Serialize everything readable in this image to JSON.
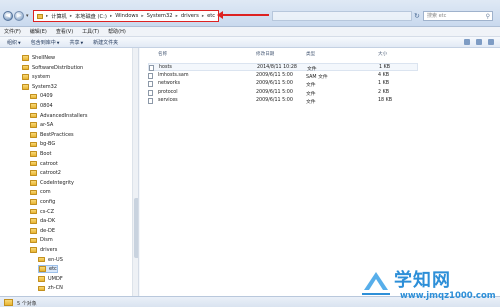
{
  "address": {
    "segments": [
      "计算机",
      "本地磁盘 (C:)",
      "Windows",
      "System32",
      "drivers",
      "etc"
    ],
    "search_placeholder": "搜索 etc"
  },
  "menu": [
    "文件(F)",
    "编辑(E)",
    "查看(V)",
    "工具(T)",
    "帮助(H)"
  ],
  "toolbar": [
    "组织",
    "包含到库中",
    "共享",
    "新建文件夹"
  ],
  "tree": {
    "items": [
      {
        "label": "ShellNew",
        "indent": 1
      },
      {
        "label": "SoftwareDistribution",
        "indent": 1
      },
      {
        "label": "system",
        "indent": 1
      },
      {
        "label": "System32",
        "indent": 1
      },
      {
        "label": "0409",
        "indent": 2
      },
      {
        "label": "0804",
        "indent": 2
      },
      {
        "label": "AdvancedInstallers",
        "indent": 2
      },
      {
        "label": "ar-SA",
        "indent": 2
      },
      {
        "label": "BestPractices",
        "indent": 2
      },
      {
        "label": "bg-BG",
        "indent": 2
      },
      {
        "label": "Boot",
        "indent": 2
      },
      {
        "label": "catroot",
        "indent": 2
      },
      {
        "label": "catroot2",
        "indent": 2
      },
      {
        "label": "CodeIntegrity",
        "indent": 2
      },
      {
        "label": "com",
        "indent": 2
      },
      {
        "label": "config",
        "indent": 2
      },
      {
        "label": "cs-CZ",
        "indent": 2
      },
      {
        "label": "da-DK",
        "indent": 2
      },
      {
        "label": "de-DE",
        "indent": 2
      },
      {
        "label": "Dism",
        "indent": 2
      },
      {
        "label": "drivers",
        "indent": 2
      },
      {
        "label": "en-US",
        "indent": 3
      },
      {
        "label": "etc",
        "indent": 3,
        "selected": true
      },
      {
        "label": "UMDF",
        "indent": 3
      },
      {
        "label": "zh-CN",
        "indent": 3
      }
    ]
  },
  "filelist": {
    "headers": [
      "名称",
      "修改日期",
      "类型",
      "大小"
    ],
    "rows": [
      {
        "name": "hosts",
        "date": "2014/8/11 10:28",
        "type": "文件",
        "size": "1 KB"
      },
      {
        "name": "lmhosts.sam",
        "date": "2009/6/11 5:00",
        "type": "SAM 文件",
        "size": "4 KB"
      },
      {
        "name": "networks",
        "date": "2009/6/11 5:00",
        "type": "文件",
        "size": "1 KB"
      },
      {
        "name": "protocol",
        "date": "2009/6/11 5:00",
        "type": "文件",
        "size": "2 KB"
      },
      {
        "name": "services",
        "date": "2009/6/11 5:00",
        "type": "文件",
        "size": "18 KB"
      }
    ]
  },
  "status": {
    "text": "5 个对象"
  },
  "watermark": {
    "title": "学知网",
    "url": "www.jmqz1000.com"
  },
  "colors": {
    "highlight": "#dd2222",
    "accent": "#2d8fd8"
  }
}
